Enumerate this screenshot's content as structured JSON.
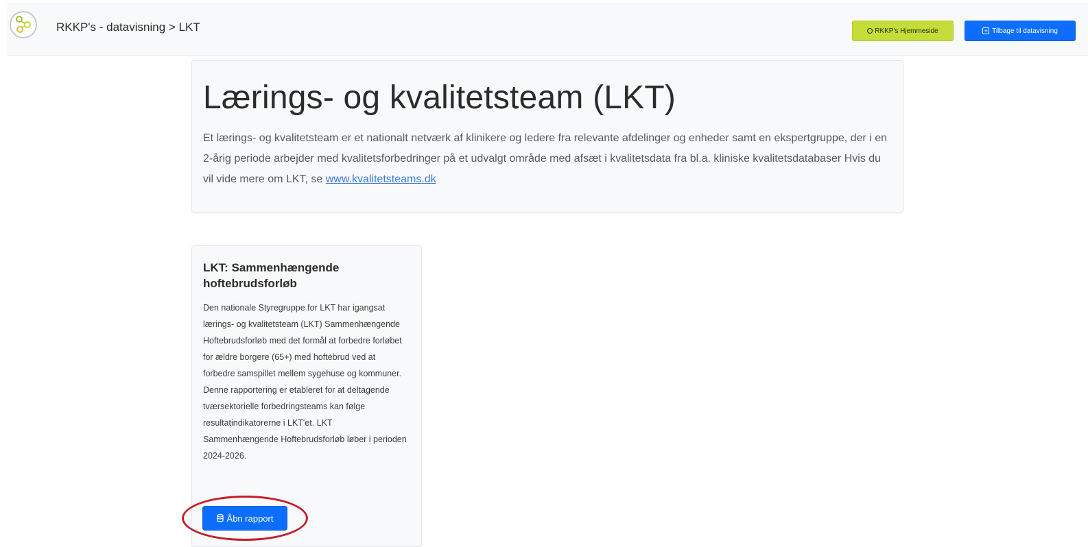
{
  "navbar": {
    "logo_icon": "rkkp-logo-icon",
    "brand_text": "RKKP's - datavisning > LKT",
    "home_button": {
      "icon": "circle-icon",
      "label": "RKKP's Hjemmeside",
      "color": "#c6dc3a"
    },
    "back_button": {
      "icon": "plus-square-icon",
      "label": "Tilbage til datavisning",
      "color": "#0d6efd"
    }
  },
  "jumbotron": {
    "title": "Lærings- og kvalitetsteam (LKT)",
    "text": "Et lærings- og kvalitetsteam er et nationalt netværk af klinikere og ledere fra relevante afdelinger og enheder samt en ekspertgruppe, der i en 2-årig periode arbejder med kvalitetsforbedringer på et udvalgt område med afsæt i kvalitetsdata fra bl.a. kliniske kvalitetsdatabaser Hvis du vil vide mere om LKT, se ",
    "link_text": "www.kvalitetsteams.dk"
  },
  "card": {
    "title": "LKT: Sammenhængende hoftebrudsforløb",
    "text": "Den nationale Styregruppe for LKT har igangsat lærings- og kvalitetsteam (LKT) Sammenhængende Hoftebrudsforløb med det formål at forbedre forløbet for ældre borgere (65+) med hoftebrud ved at forbedre samspillet mellem sygehuse og kommuner. Denne rapportering er etableret for at deltagende tværsektorielle forbedringsteams kan følge resultatindikatorerne i LKT'et. LKT Sammenhængende Hoftebrudsforløb løber i perioden 2024-2026.",
    "button": {
      "icon": "database-icon",
      "label": "Åbn rapport",
      "color": "#0d6efd"
    }
  },
  "annotation": {
    "highlight_color": "#c41e2a"
  }
}
